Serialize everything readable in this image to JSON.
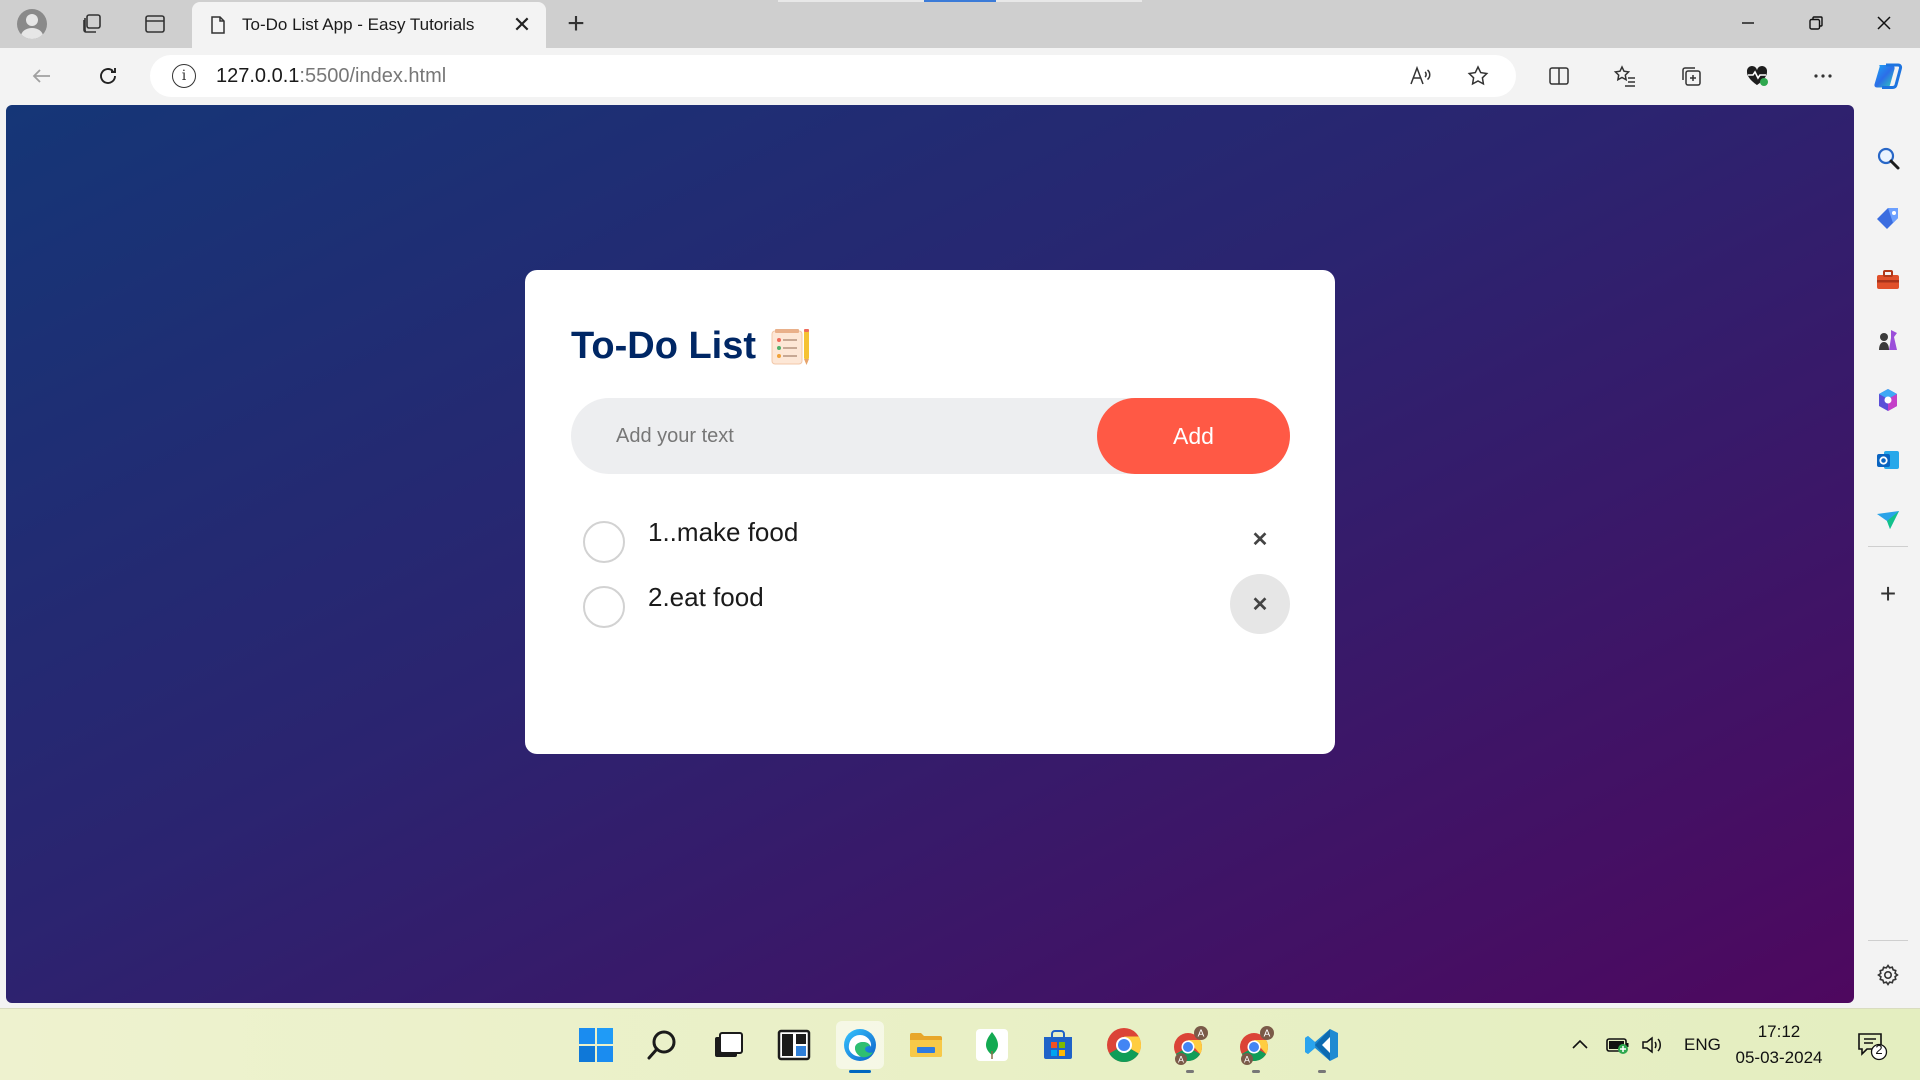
{
  "browser": {
    "tab_title": "To-Do List App - Easy Tutorials",
    "url_host": "127.0.0.1",
    "url_rest": ":5500/index.html"
  },
  "app": {
    "title": "To-Do List",
    "input_placeholder": "Add your text",
    "add_label": "Add",
    "tasks": [
      {
        "text": "1..make food",
        "done": false
      },
      {
        "text": "2.eat food",
        "done": false
      }
    ],
    "colors": {
      "accent": "#ff5945",
      "title": "#002765",
      "gradient_start": "#153677",
      "gradient_end": "#4e085f"
    }
  },
  "taskbar": {
    "language": "ENG",
    "time": "17:12",
    "date": "05-03-2024",
    "notification_count": "2",
    "apps": [
      "start-icon",
      "search-icon",
      "task-view-icon",
      "widgets-icon",
      "edge-icon",
      "file-explorer-icon",
      "mongodb-compass-icon",
      "microsoft-store-icon",
      "chrome-icon",
      "chrome-profile-icon",
      "chrome-profile-icon",
      "vscode-icon"
    ]
  }
}
